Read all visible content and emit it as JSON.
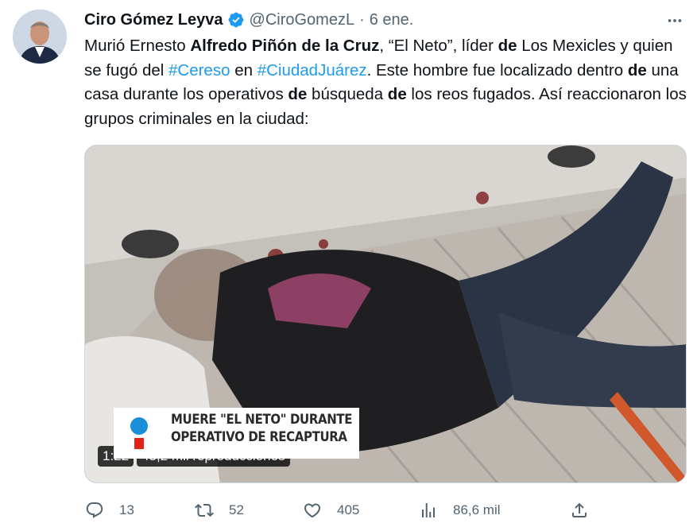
{
  "tweet": {
    "author_name": "Ciro Gómez Leyva",
    "handle": "@CiroGomezL",
    "separator": "·",
    "date": "6 ene.",
    "text": {
      "p1": "Murió Ernesto ",
      "b1": "Alfredo Piñón de la Cruz",
      "p2": ", “El Neto”, líder ",
      "b2": "de",
      "p3": " Los Mexicles y quien se fugó del ",
      "h1": "#Cereso",
      "p4": " en ",
      "h2": "#CiudadJuárez",
      "p5": ". Este hombre fue localizado dentro ",
      "b3": "de",
      "p6": " una casa durante los operativos ",
      "b4": "de",
      "p7": " búsqueda ",
      "b5": "de",
      "p8": " los reos fugados. Así reaccionaron los grupos criminales en la ciudad:"
    },
    "media": {
      "banner_line1": "MUERE \"EL NETO\" DURANTE",
      "banner_line2": "OPERATIVO DE RECAPTURA",
      "duration": "1:22",
      "views": "43,2 mil reproducciones"
    },
    "actions": {
      "replies": "13",
      "retweets": "52",
      "likes": "405",
      "views": "86,6 mil"
    }
  },
  "colors": {
    "accent": "#1d9bf0",
    "text": "#0f1419",
    "muted": "#536471"
  },
  "icons": [
    "verified-badge-icon",
    "more-icon",
    "reply-icon",
    "retweet-icon",
    "like-icon",
    "views-icon",
    "share-icon"
  ]
}
